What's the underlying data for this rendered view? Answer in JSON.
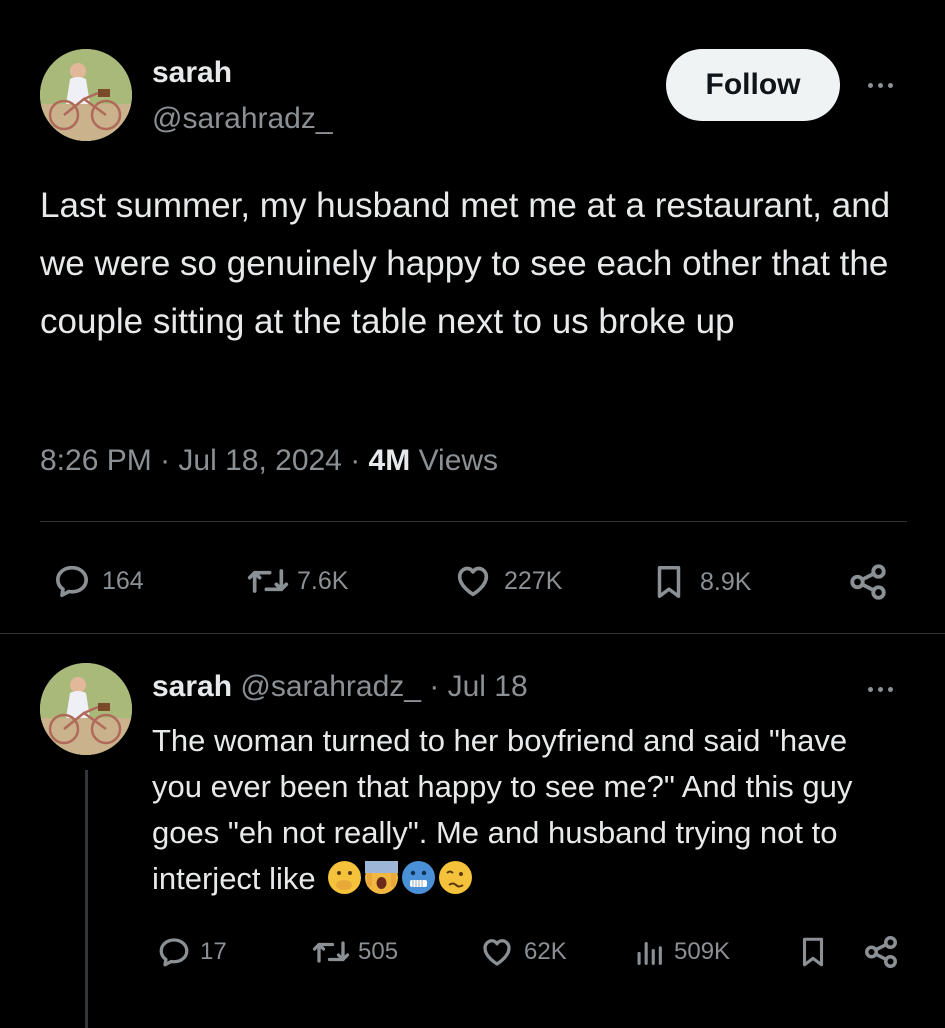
{
  "tweet": {
    "author_name": "sarah",
    "author_handle": "@sarahradz_",
    "follow_label": "Follow",
    "text": "Last summer, my husband met me at a restaurant, and we were so genuinely happy to see each other that the couple sitting at the table next to us broke up",
    "time": "8:26 PM",
    "date": "Jul 18, 2024",
    "views_count": "4M",
    "views_label": "Views",
    "stats": {
      "replies": "164",
      "reposts": "7.6K",
      "likes": "227K",
      "bookmarks": "8.9K"
    }
  },
  "reply": {
    "author_name": "sarah",
    "author_handle": "@sarahradz_",
    "date": "Jul 18",
    "text": "The woman turned to her boyfriend and said \"have you ever been that happy to see me?\" And this guy goes \"eh not really\". Me and husband trying not to interject like",
    "emojis": [
      "face-with-hand-over-mouth",
      "face-screaming-in-fear",
      "cold-face",
      "woozy-face"
    ],
    "stats": {
      "replies": "17",
      "reposts": "505",
      "likes": "62K",
      "views": "509K"
    }
  },
  "colors": {
    "background": "#000000",
    "text": "#e7e9ea",
    "muted": "#8b9095",
    "divider": "#2f3336",
    "follow_bg": "#eff3f4"
  }
}
